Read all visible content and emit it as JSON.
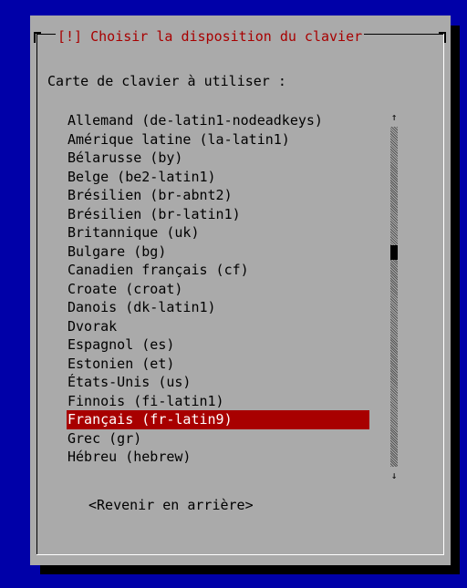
{
  "dialog": {
    "title": "[!] Choisir la disposition du clavier",
    "prompt": "Carte de clavier à utiliser :",
    "back_button": "<Revenir en arrière>"
  },
  "keymaps": [
    {
      "label": "Allemand (de-latin1-nodeadkeys)",
      "selected": false
    },
    {
      "label": "Amérique latine (la-latin1)",
      "selected": false
    },
    {
      "label": "Bélarusse (by)",
      "selected": false
    },
    {
      "label": "Belge (be2-latin1)",
      "selected": false
    },
    {
      "label": "Brésilien (br-abnt2)",
      "selected": false
    },
    {
      "label": "Brésilien (br-latin1)",
      "selected": false
    },
    {
      "label": "Britannique (uk)",
      "selected": false
    },
    {
      "label": "Bulgare (bg)",
      "selected": false
    },
    {
      "label": "Canadien français (cf)",
      "selected": false
    },
    {
      "label": "Croate (croat)",
      "selected": false
    },
    {
      "label": "Danois (dk-latin1)",
      "selected": false
    },
    {
      "label": "Dvorak",
      "selected": false
    },
    {
      "label": "Espagnol (es)",
      "selected": false
    },
    {
      "label": "Estonien (et)",
      "selected": false
    },
    {
      "label": "États-Unis (us)",
      "selected": false
    },
    {
      "label": "Finnois (fi-latin1)",
      "selected": false
    },
    {
      "label": "Français (fr-latin9)",
      "selected": true
    },
    {
      "label": "Grec (gr)",
      "selected": false
    },
    {
      "label": "Hébreu (hebrew)",
      "selected": false
    }
  ],
  "scrollbar": {
    "up_icon": "arrow-up-icon",
    "down_icon": "arrow-down-icon",
    "up_glyph": "↑",
    "down_glyph": "↓"
  },
  "colors": {
    "background": "#0000a8",
    "dialog": "#aaaaaa",
    "title_text": "#a80000",
    "selection": "#a80000"
  }
}
